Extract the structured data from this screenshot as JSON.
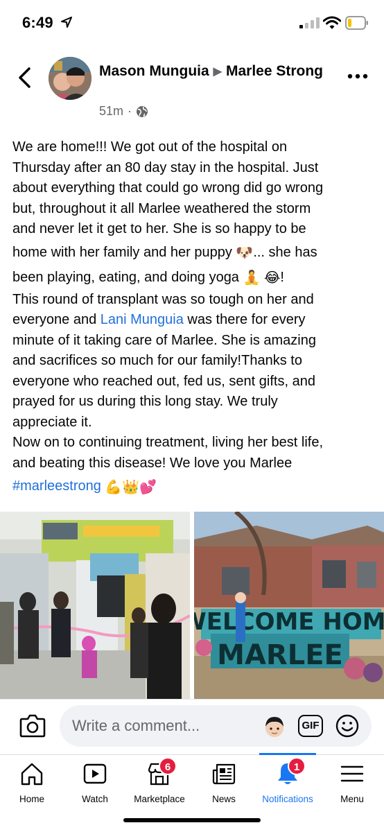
{
  "status_bar": {
    "time": "6:49"
  },
  "post": {
    "author": "Mason Munguia",
    "arrow": "▶",
    "group": "Marlee Strong",
    "timestamp": "51m",
    "separator": "·",
    "body_lines": [
      "We are home!!! We got out of the hospital on",
      "Thursday after an 80 day stay in the hospital. Just",
      "about everything that could go wrong did go wrong",
      "but, throughout it all Marlee weathered the storm",
      "and never let it get to her. She is so happy to be"
    ],
    "line6_text": "home with her family and her puppy",
    "line6_emoji": "🐶",
    "line6_tail": "... she has",
    "line7_text": "been playing, eating, and doing yoga",
    "line7_emoji1": "🧘",
    "line7_emoji2": "😂",
    "line7_tail": "!",
    "line8": "This round of transplant was so tough on her and",
    "line9_pre": "everyone and ",
    "line9_mention": "Lani Munguia",
    "line9_post": " was there for every",
    "body_lines_2": [
      "minute of it taking care of Marlee. She is amazing",
      "and sacrifices so much for our family!Thanks to",
      "everyone who reached out, fed us, sent gifts, and",
      "prayed for us during this long stay. We truly",
      "appreciate it.",
      "Now on to continuing treatment, living her best life,",
      "and beating this disease! We love you Marlee"
    ],
    "hashtag": "#marleestrong",
    "hashtag_emojis": "💪👑💕",
    "yard_sign_top": "WELCOME HOME",
    "yard_sign_bottom": "MARLEE"
  },
  "comment_bar": {
    "placeholder": "Write a comment...",
    "gif_label": "GIF"
  },
  "tabs": [
    {
      "label": "Home",
      "icon": "home-icon"
    },
    {
      "label": "Watch",
      "icon": "watch-icon"
    },
    {
      "label": "Marketplace",
      "icon": "marketplace-icon",
      "badge": "6"
    },
    {
      "label": "News",
      "icon": "news-icon"
    },
    {
      "label": "Notifications",
      "icon": "bell-icon",
      "badge": "1",
      "active": true
    },
    {
      "label": "Menu",
      "icon": "menu-icon"
    }
  ],
  "colors": {
    "accent": "#1877f2",
    "link": "#216fdb",
    "badge": "#e41e3f",
    "secondary_text": "#65676b"
  }
}
